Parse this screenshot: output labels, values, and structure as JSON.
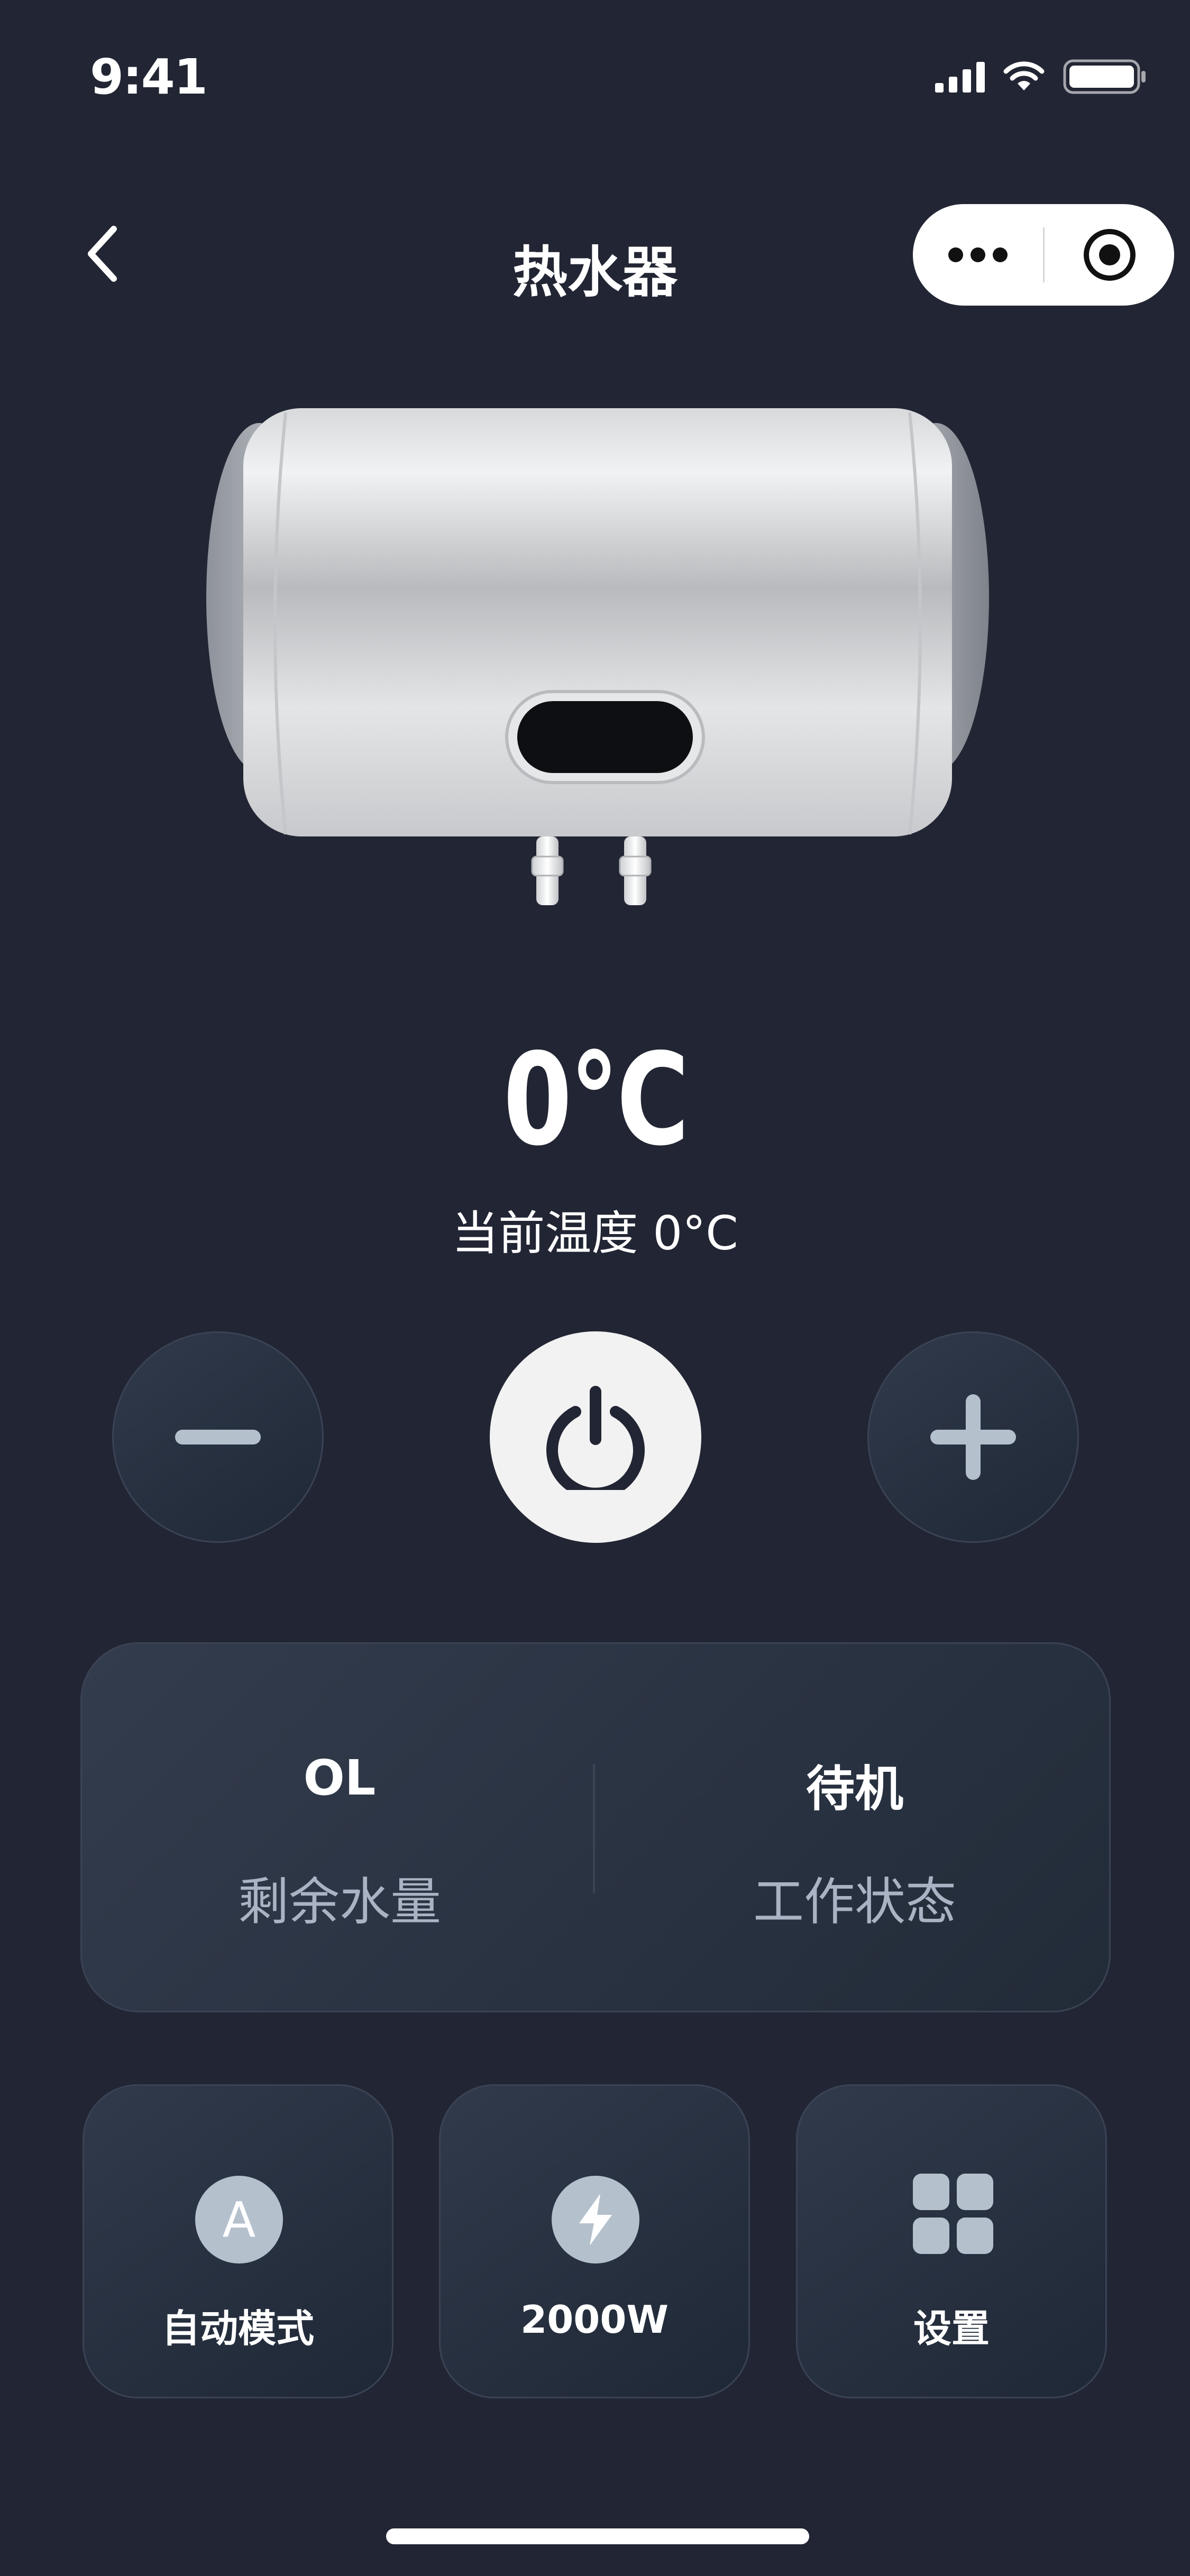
{
  "status_bar": {
    "time": "9:41"
  },
  "nav": {
    "title": "热水器"
  },
  "temperature": {
    "target": "0°C",
    "current_text": "当前温度 0°C"
  },
  "info": {
    "water": {
      "value": "OL",
      "label": "剩余水量"
    },
    "status": {
      "value": "待机",
      "label": "工作状态"
    }
  },
  "tiles": [
    {
      "icon_letter": "A",
      "label": "自动模式",
      "icon": "auto-mode-icon"
    },
    {
      "label": "2000W",
      "icon": "lightning-icon"
    },
    {
      "label": "设置",
      "icon": "grid-icon"
    }
  ],
  "colors": {
    "background": "#222533",
    "card": "#2b3444",
    "icon_fill": "#b5c0cd",
    "power_button": "#f2f2f2"
  }
}
